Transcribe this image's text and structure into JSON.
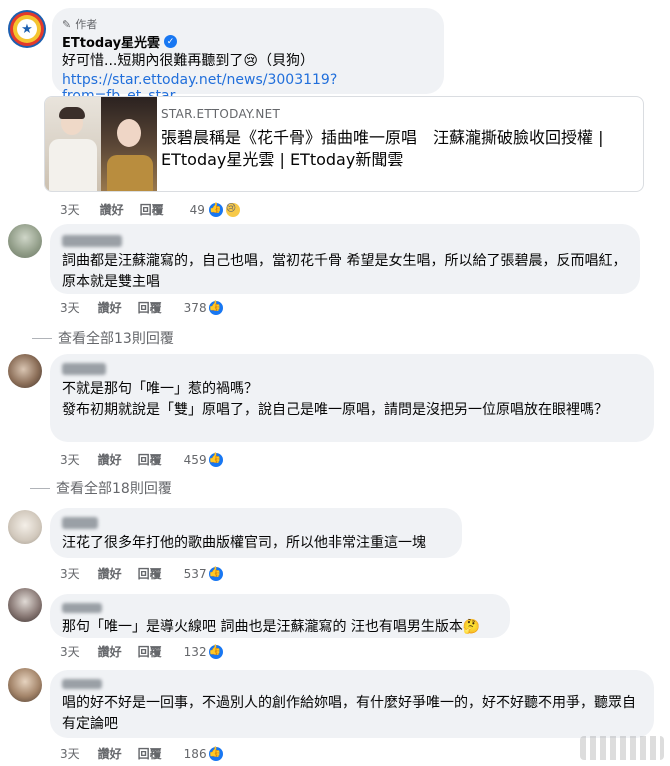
{
  "post": {
    "author_tag": "作者",
    "author_name": "ETtoday星光雲",
    "text": "好可惜...短期內很難再聽到了",
    "text_suffix": "（貝狗）",
    "link_url": "https://star.ettoday.net/news/3003119?from=fb_et_star",
    "card": {
      "domain": "STAR.ETTODAY.NET",
      "title": "張碧晨稱是《花千骨》插曲唯一原唱　汪蘇瀧撕破臉收回授權 | ETtoday星光雲 | ETtoday新聞雲"
    },
    "meta": {
      "time": "3天",
      "like": "讚好",
      "reply": "回覆",
      "count": "49"
    }
  },
  "comments": [
    {
      "text": "詞曲都是汪蘇瀧寫的，自己也唱，當初花千骨 希望是女生唱，所以給了張碧晨，反而唱紅，原本就是雙主唱",
      "meta": {
        "time": "3天",
        "like": "讚好",
        "reply": "回覆",
        "count": "378"
      },
      "view_replies": "查看全部13則回覆"
    },
    {
      "text_line1": "不就是那句「唯一」惹的禍嗎？",
      "text_line2": "發布初期就說是「雙」原唱了，說自己是唯一原唱，請問是沒把另一位原唱放在眼裡嗎？",
      "meta": {
        "time": "3天",
        "like": "讚好",
        "reply": "回覆",
        "count": "459"
      },
      "view_replies": "查看全部18則回覆"
    },
    {
      "text": "汪花了很多年打他的歌曲版權官司，所以他非常注重這一塊",
      "meta": {
        "time": "3天",
        "like": "讚好",
        "reply": "回覆",
        "count": "537"
      }
    },
    {
      "text": "那句「唯一」是導火線吧 詞曲也是汪蘇瀧寫的 汪也有唱男生版本",
      "meta": {
        "time": "3天",
        "like": "讚好",
        "reply": "回覆",
        "count": "132"
      }
    },
    {
      "text": "唱的好不好是一回事，不過別人的創作給妳唱，有什麼好爭唯一的，好不好聽不用爭，聽眾自有定論吧",
      "meta": {
        "time": "3天",
        "like": "讚好",
        "reply": "回覆",
        "count": "186"
      }
    }
  ],
  "icons": {
    "like": "thumbs-up-icon",
    "sad": "sad-face-icon",
    "verified": "verified-check-icon",
    "author_tag": "pencil-icon",
    "thinking": "thinking-face-icon"
  },
  "colors": {
    "bubble": "#f0f2f5",
    "link": "#216fdb",
    "like_blue": "#1877f2",
    "meta_gray": "#65676b"
  }
}
